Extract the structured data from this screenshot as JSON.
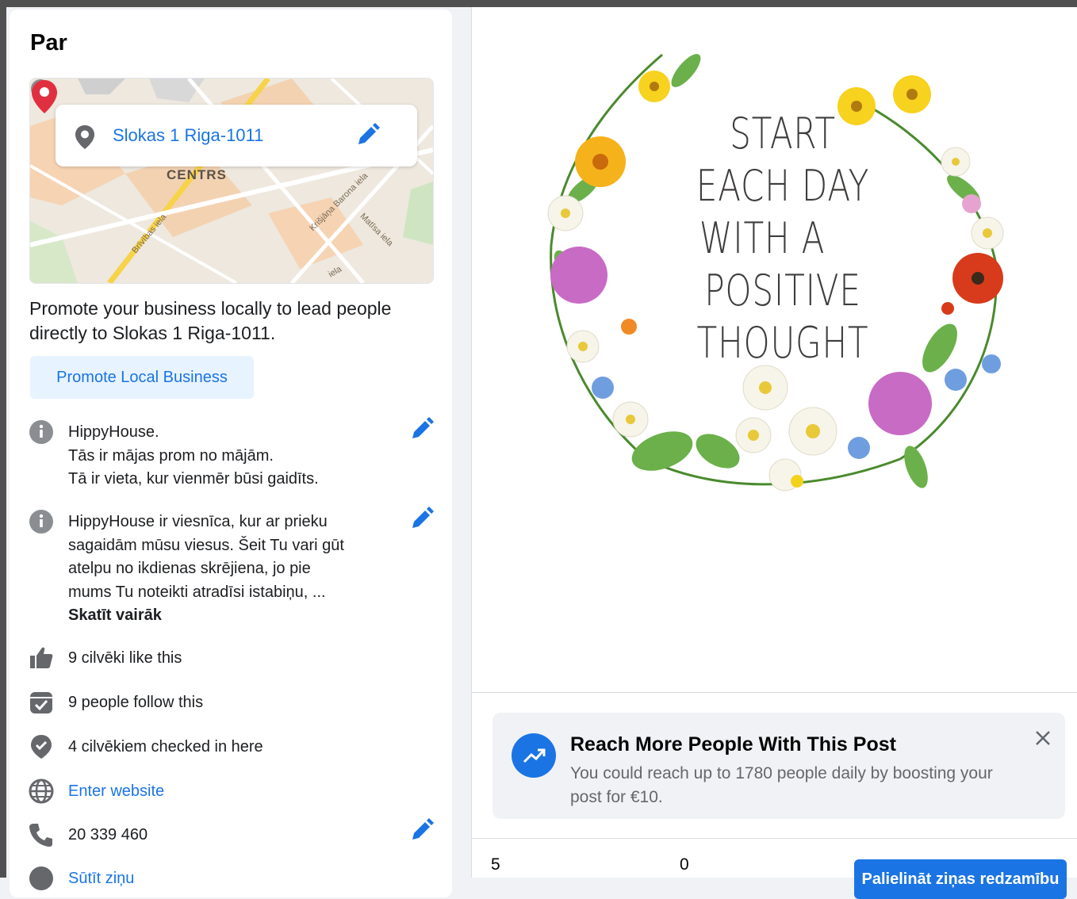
{
  "about": {
    "title": "Par",
    "map": {
      "address": "Slokas 1 Riga-1011",
      "district": "CENTRS",
      "streets": [
        "Brīvības iela",
        "Krišjāņa Barona iela",
        "Matīsa iela",
        "iela"
      ],
      "icons": {
        "pin": "location-pin-icon",
        "edit": "pencil-icon",
        "info": "info-icon",
        "marker": "map-marker-icon"
      }
    },
    "promote_text": "Promote your business locally to lead people directly to Slokas 1 Riga-1011.",
    "promote_button": "Promote Local Business",
    "intro": {
      "line1": "HippyHouse.",
      "line2": "Tās ir mājas prom no mājām.",
      "line3": "Tā ir vieta, kur vienmēr būsi gaidīts."
    },
    "description": {
      "line1": "HippyHouse ir viesnīca, kur ar prieku",
      "line2": "sagaidām mūsu viesus. Šeit Tu vari gūt",
      "line3": "atelpu no ikdienas skrējiena, jo pie",
      "line4": "mums Tu noteikti atradīsi istabiņu, ...",
      "see_more": "Skatīt vairāk"
    },
    "likes": "9 cilvēki like this",
    "follows": "9 people follow this",
    "checkins": "4 cilvēkiem checked in here",
    "website": "Enter website",
    "phone": "20 339 460",
    "message": "Sūtīt ziņu"
  },
  "post": {
    "image_quote": [
      "START",
      "EACH DAY",
      "WITH A",
      "POSITIVE",
      "THOUGHT"
    ],
    "boost": {
      "title": "Reach More People With This Post",
      "body": "You could reach up to 1780 people daily by boosting your post for €10.",
      "icon": "trending-up-icon",
      "close_icon": "close-icon"
    },
    "stats": {
      "first": "5",
      "second": "0"
    },
    "boost_button": "Palielināt ziņas redzamību"
  },
  "colors": {
    "accent": "#1b74e4",
    "accent_light": "#e7f3ff",
    "text": "#1c1e21",
    "muted": "#65676b",
    "icon_gray": "#65676b"
  }
}
